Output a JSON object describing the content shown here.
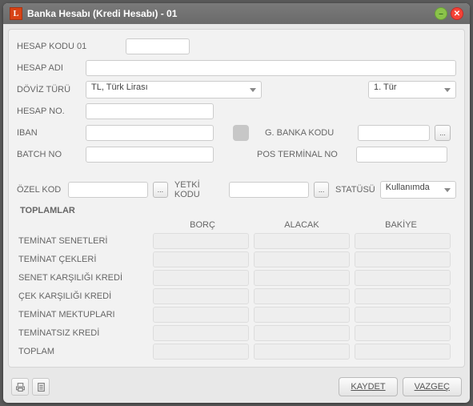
{
  "window": {
    "title": "Banka Hesabı (Kredi Hesabı) - 01"
  },
  "fields": {
    "hesap_kodu_label": "HESAP KODU 01",
    "hesap_adi_label": "HESAP ADI",
    "doviz_turu_label": "DÖVİZ TÜRÜ",
    "doviz_turu_value": "TL, Türk Lirası",
    "doviz_tur_sel": "1. Tür",
    "hesap_no_label": "HESAP NO.",
    "iban_label": "IBAN",
    "g_banka_kodu_label": "G. BANKA KODU",
    "batch_no_label": "BATCH NO",
    "pos_terminal_label": "POS TERMİNAL NO",
    "ozel_kod_label": "ÖZEL KOD",
    "yetki_kodu_label": "YETKİ KODU",
    "statusu_label": "STATÜSÜ",
    "statusu_value": "Kullanımda"
  },
  "totals": {
    "title": "TOPLAMLAR",
    "columns": {
      "borc": "BORÇ",
      "alacak": "ALACAK",
      "bakiye": "BAKİYE"
    },
    "rows": [
      "TEMİNAT SENETLERİ",
      "TEMİNAT ÇEKLERİ",
      "SENET KARŞILIĞI KREDİ",
      "ÇEK KARŞILIĞI KREDİ",
      "TEMİNAT MEKTUPLARI",
      "TEMİNATSIZ KREDİ",
      "TOPLAM"
    ]
  },
  "footer": {
    "save": "KAYDET",
    "cancel": "VAZGEÇ"
  },
  "lookup_btn": "..."
}
